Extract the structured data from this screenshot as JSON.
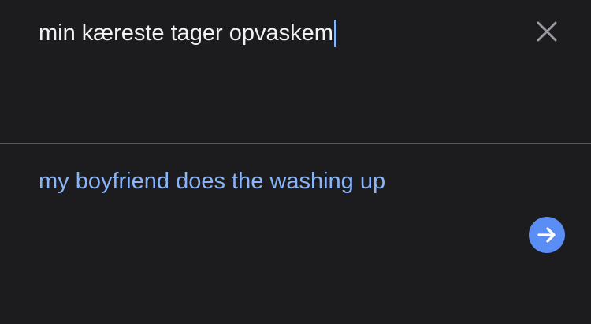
{
  "source": {
    "text": "min kæreste tager opvaskem",
    "text_color": "#f2f2f2",
    "caret_color": "#8ab4f8"
  },
  "clear_button": {
    "icon": "close-icon",
    "color": "#9a9a9e"
  },
  "divider": {
    "color": "#5a5a5e"
  },
  "translation": {
    "text": "my boyfriend does the washing up",
    "color": "#8ab4f8"
  },
  "go_button": {
    "icon": "arrow-right-icon",
    "background": "#5b8ef4",
    "icon_color": "#ffffff"
  },
  "background": "#1c1c1e"
}
